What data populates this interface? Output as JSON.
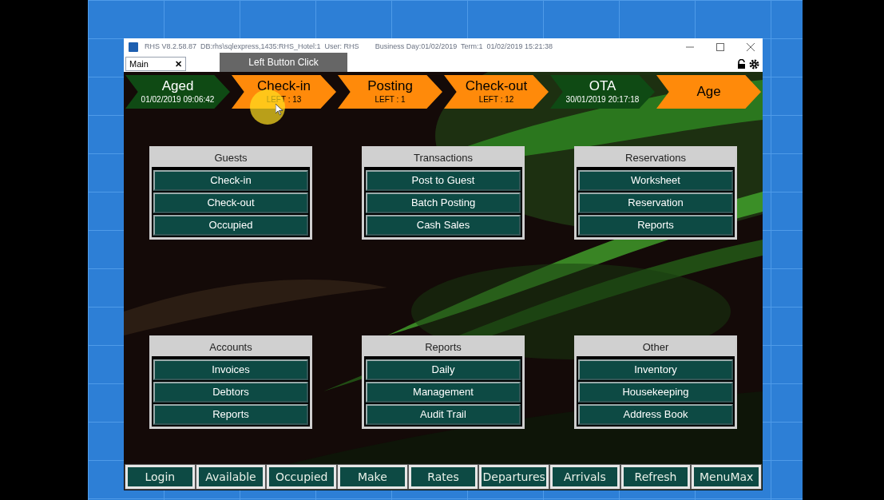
{
  "window": {
    "title": "RHS V8.2.58.87  DB:rhs\\sqlexpress,1435:RHS_Hotel:1  User: RHS",
    "business_day": "Business Day:01/02/2019  Term:1  01/02/2019 15:21:38"
  },
  "tab": {
    "label": "Main",
    "close": "✕"
  },
  "tooltip": "Left Button Click",
  "status_chevrons": [
    {
      "title": "Aged",
      "subtitle": "01/02/2019 09:06:42",
      "color": "#0f4a14"
    },
    {
      "title": "Check-in",
      "subtitle": "LEFT : 13",
      "color": "#ff8a0a"
    },
    {
      "title": "Posting",
      "subtitle": "LEFT : 1",
      "color": "#ff8a0a"
    },
    {
      "title": "Check-out",
      "subtitle": "LEFT : 12",
      "color": "#ff8a0a"
    },
    {
      "title": "OTA",
      "subtitle": "30/01/2019 20:17:18",
      "color": "#0f4a14"
    },
    {
      "title": "Age",
      "color": "#ff8a0a"
    }
  ],
  "groups": [
    {
      "title": "Guests",
      "items": [
        "Check-in",
        "Check-out",
        "Occupied"
      ]
    },
    {
      "title": "Transactions",
      "items": [
        "Post to Guest",
        "Batch Posting",
        "Cash Sales"
      ]
    },
    {
      "title": "Reservations",
      "items": [
        "Worksheet",
        "Reservation",
        "Reports"
      ]
    },
    {
      "title": "Accounts",
      "items": [
        "Invoices",
        "Debtors",
        "Reports"
      ]
    },
    {
      "title": "Reports",
      "items": [
        "Daily",
        "Management",
        "Audit Trail"
      ]
    },
    {
      "title": "Other",
      "items": [
        "Inventory",
        "Housekeeping",
        "Address Book"
      ]
    }
  ],
  "bottom_buttons": [
    "Login",
    "Available",
    "Occupied",
    "Make",
    "Rates",
    "Departures",
    "Arrivals",
    "Refresh",
    "MenuMax"
  ]
}
